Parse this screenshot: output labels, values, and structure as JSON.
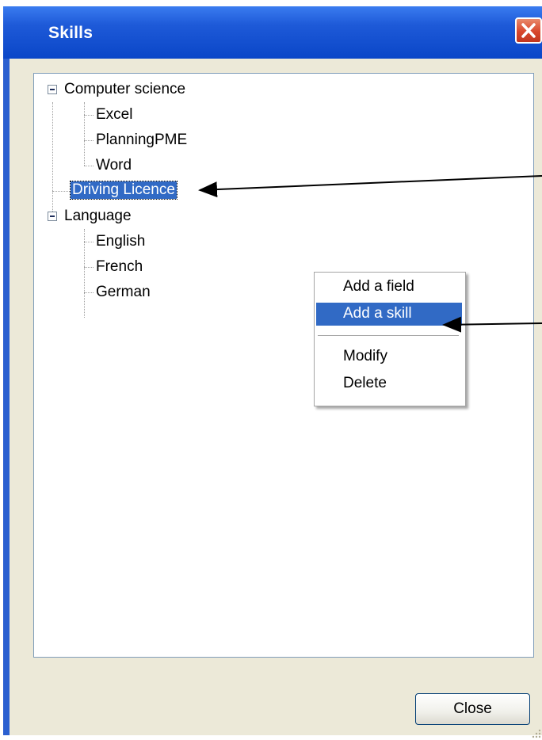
{
  "window": {
    "title": "Skills"
  },
  "tree": {
    "computer_science": {
      "label": "Computer science",
      "children": [
        "Excel",
        "PlanningPME",
        "Word"
      ]
    },
    "driving_licence": {
      "label": "Driving Licence",
      "selected": true
    },
    "language": {
      "label": "Language",
      "children": [
        "English",
        "French",
        "German"
      ]
    }
  },
  "context_menu": {
    "items": [
      "Add a field",
      "Add a skill",
      "Modify",
      "Delete"
    ],
    "highlighted": "Add a skill"
  },
  "buttons": {
    "close": "Close"
  },
  "colors": {
    "titlebar": "#0a46c8",
    "selection": "#316ac5",
    "face": "#ece9d8",
    "close_red": "#d8472c"
  }
}
